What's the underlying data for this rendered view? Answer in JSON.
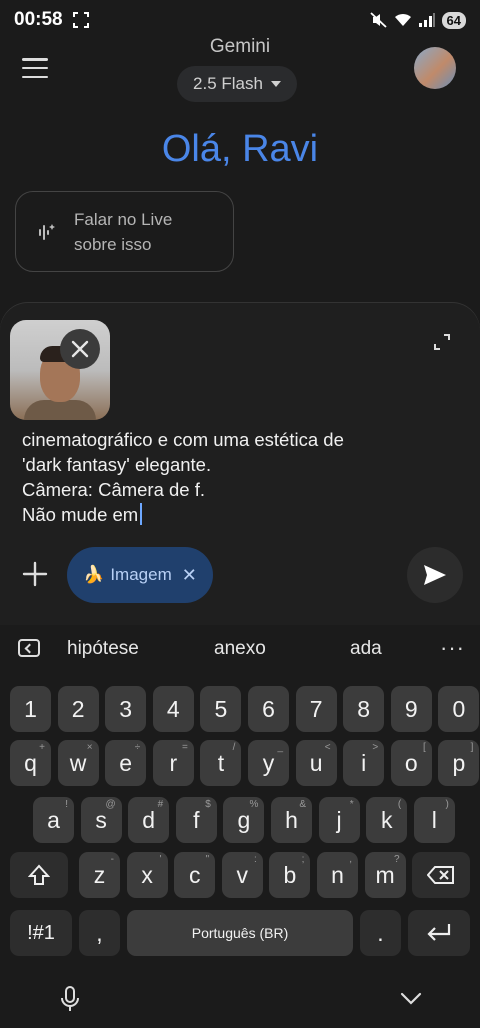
{
  "status": {
    "time": "00:58",
    "battery": "64"
  },
  "header": {
    "title": "Gemini",
    "model": "2.5 Flash"
  },
  "greeting": "Olá, Ravi",
  "live_card": {
    "line1": "Falar no Live",
    "line2": "sobre isso"
  },
  "composer": {
    "text": "cinematográfico e com uma estética de\n'dark fantasy' elegante.\nCâmera: Câmera de f.\nNão mude em",
    "chip_label": "Imagem",
    "chip_emoji": "🍌"
  },
  "suggestions": [
    "hipótese",
    "anexo",
    "ada"
  ],
  "keyboard": {
    "row1": [
      "1",
      "2",
      "3",
      "4",
      "5",
      "6",
      "7",
      "8",
      "9",
      "0"
    ],
    "row2": [
      "q",
      "w",
      "e",
      "r",
      "t",
      "y",
      "u",
      "i",
      "o",
      "p"
    ],
    "row2_hints": [
      "+",
      "×",
      "÷",
      "=",
      "/",
      "_",
      "<",
      ">",
      "[",
      "]"
    ],
    "row3": [
      "a",
      "s",
      "d",
      "f",
      "g",
      "h",
      "j",
      "k",
      "l"
    ],
    "row3_hints": [
      "!",
      "@",
      "#",
      "$",
      "%",
      "&",
      "*",
      "(",
      ")"
    ],
    "row4": [
      "z",
      "x",
      "c",
      "v",
      "b",
      "n",
      "m"
    ],
    "row4_hints": [
      "-",
      "'",
      "\"",
      ":",
      ";",
      ",",
      "?"
    ],
    "symbols_key": "!#1",
    "comma": ",",
    "space": "Português (BR)",
    "period": "."
  }
}
